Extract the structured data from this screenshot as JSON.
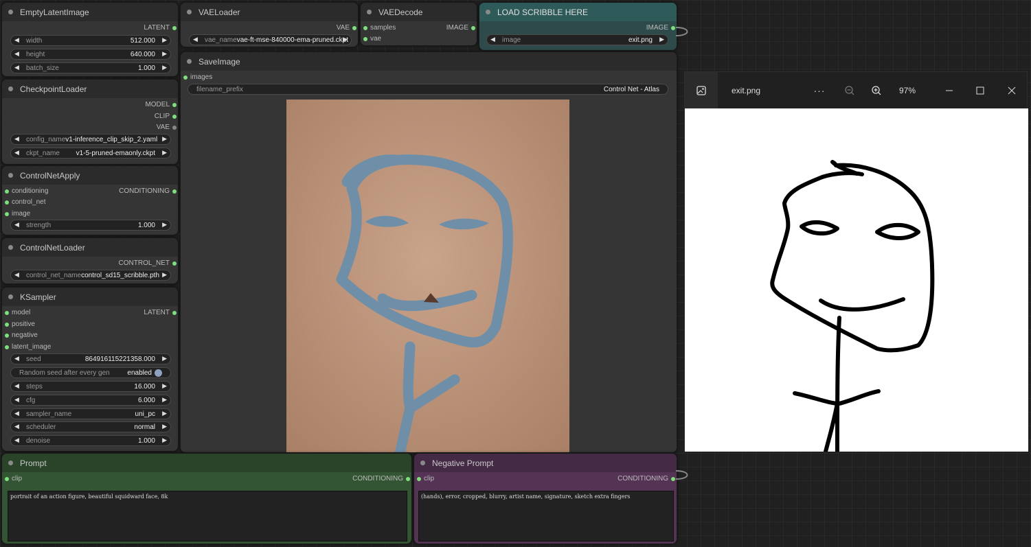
{
  "empty_latent": {
    "title": "EmptyLatentImage",
    "out_latent": "LATENT",
    "width_label": "width",
    "width_value": "512.000",
    "height_label": "height",
    "height_value": "640.000",
    "batch_label": "batch_size",
    "batch_value": "1.000"
  },
  "checkpoint": {
    "title": "CheckpointLoader",
    "out_model": "MODEL",
    "out_clip": "CLIP",
    "out_vae": "VAE",
    "config_label": "config_name",
    "config_value": "v1-inference_clip_skip_2.yaml",
    "ckpt_label": "ckpt_name",
    "ckpt_value": "v1-5-pruned-emaonly.ckpt"
  },
  "controlnet_apply": {
    "title": "ControlNetApply",
    "in_conditioning": "conditioning",
    "in_control_net": "control_net",
    "in_image": "image",
    "out_conditioning": "CONDITIONING",
    "strength_label": "strength",
    "strength_value": "1.000"
  },
  "controlnet_loader": {
    "title": "ControlNetLoader",
    "out": "CONTROL_NET",
    "name_label": "control_net_name",
    "name_value": "control_sd15_scribble.pth"
  },
  "ksampler": {
    "title": "KSampler",
    "in_model": "model",
    "in_positive": "positive",
    "in_negative": "negative",
    "in_latent": "latent_image",
    "out_latent": "LATENT",
    "seed_label": "seed",
    "seed_value": "864916115221358.000",
    "random_label": "Random seed after every gen",
    "random_value": "enabled",
    "steps_label": "steps",
    "steps_value": "16.000",
    "cfg_label": "cfg",
    "cfg_value": "6.000",
    "sampler_label": "sampler_name",
    "sampler_value": "uni_pc",
    "scheduler_label": "scheduler",
    "scheduler_value": "normal",
    "denoise_label": "denoise",
    "denoise_value": "1.000"
  },
  "vae_loader": {
    "title": "VAELoader",
    "out_vae": "VAE",
    "name_label": "vae_name",
    "name_value": "vae-ft-mse-840000-ema-pruned.ckpt"
  },
  "vae_decode": {
    "title": "VAEDecode",
    "in_samples": "samples",
    "in_vae": "vae",
    "out_image": "IMAGE"
  },
  "load_scribble": {
    "title": "LOAD SCRIBBLE HERE",
    "out_image": "IMAGE",
    "image_label": "image",
    "image_value": "exit.png"
  },
  "save_image": {
    "title": "SaveImage",
    "in_images": "images",
    "prefix_label": "filename_prefix",
    "prefix_value": "Control Net - Atlas"
  },
  "prompt": {
    "title": "Prompt",
    "in_clip": "clip",
    "out_conditioning": "CONDITIONING",
    "text": "portrait of an action figure, beautiful squidward face, 8k"
  },
  "negative_prompt": {
    "title": "Negative Prompt",
    "in_clip": "clip",
    "out_conditioning": "CONDITIONING",
    "text": "(hands), error, cropped, blurry, artist name, signature, sketch extra fingers"
  },
  "viewer": {
    "filename": "exit.png",
    "more": "···",
    "zoom": "97%"
  },
  "colors": {
    "slot_active": "#7de07d",
    "prompt_node": "#2f4a2f",
    "negative_node": "#4a2f4a",
    "scribble_title": "#2f5a5a",
    "canvas": "#202020"
  }
}
